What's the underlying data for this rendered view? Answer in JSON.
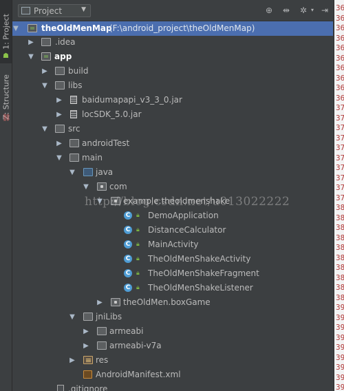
{
  "toolstrip": {
    "project_tab": "1: Project",
    "structure_tab": "Z: Structure"
  },
  "header": {
    "selector_label": "Project",
    "buttons": [
      "target-icon",
      "split-icon",
      "gear-icon",
      "hide-icon"
    ]
  },
  "tree": {
    "root_name": "theOldMenMap",
    "root_path": "(F:\\android_project\\theOldMenMap)",
    "items": [
      {
        "label": ".idea"
      },
      {
        "label": "app"
      },
      {
        "label": "build"
      },
      {
        "label": "libs"
      },
      {
        "label": "baidumapapi_v3_3_0.jar"
      },
      {
        "label": "locSDK_5.0.jar"
      },
      {
        "label": "src"
      },
      {
        "label": "androidTest"
      },
      {
        "label": "main"
      },
      {
        "label": "java"
      },
      {
        "label": "com"
      },
      {
        "label": "example.theoldmenshake"
      },
      {
        "label": "DemoApplication"
      },
      {
        "label": "DistanceCalculator"
      },
      {
        "label": "MainActivity"
      },
      {
        "label": "TheOldMenShakeActivity"
      },
      {
        "label": "TheOldMenShakeFragment"
      },
      {
        "label": "TheOldMenShakeListener"
      },
      {
        "label": "theOldMen.boxGame"
      },
      {
        "label": "jniLibs"
      },
      {
        "label": "armeabi"
      },
      {
        "label": "armeabi-v7a"
      },
      {
        "label": "res"
      },
      {
        "label": "AndroidManifest.xml"
      },
      {
        "label": ".gitignore"
      }
    ]
  },
  "watermark": "http://blog.csdn.net/u013022222",
  "gutter_lines": [
    "36",
    "36",
    "36",
    "36",
    "36",
    "36",
    "36",
    "36",
    "36",
    "36",
    "37",
    "37",
    "37",
    "37",
    "37",
    "37",
    "37",
    "37",
    "37",
    "37",
    "38",
    "38",
    "38",
    "38",
    "38",
    "38",
    "38",
    "38",
    "38",
    "38",
    "39",
    "39",
    "39",
    "39",
    "39",
    "39",
    "39",
    "39",
    "39",
    "39"
  ]
}
